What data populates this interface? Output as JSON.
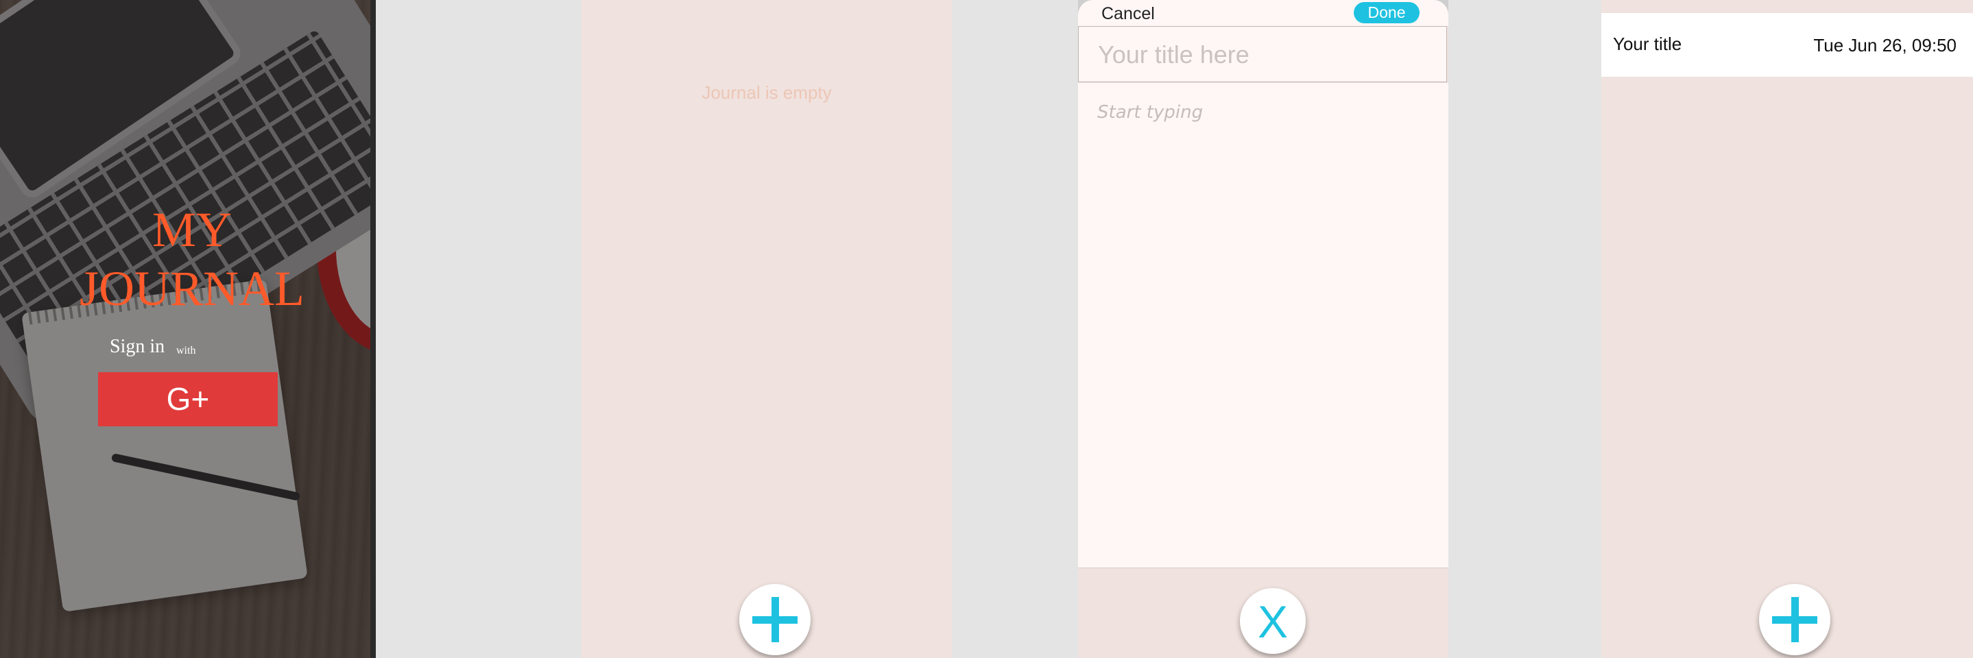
{
  "login": {
    "title_line1": "MY",
    "title_line2": "JOURNAL",
    "sign_in": "Sign in",
    "with": "with",
    "google_button": "G+"
  },
  "empty_journal": {
    "message": "Journal is empty",
    "fab_icon": "plus-icon"
  },
  "editor": {
    "cancel_label": "Cancel",
    "done_label": "Done",
    "title_placeholder": "Your title here",
    "body_placeholder": "Start typing",
    "close_label": "X"
  },
  "journal_list": {
    "entries": [
      {
        "title": "Your title",
        "date": "Tue Jun 26, 09:50"
      }
    ],
    "fab_icon": "plus-icon"
  },
  "colors": {
    "accent": "#1ec2e0",
    "title_orange": "#ff5a2a",
    "google_red": "#e03b3a",
    "background_pink": "#f0e2de"
  }
}
